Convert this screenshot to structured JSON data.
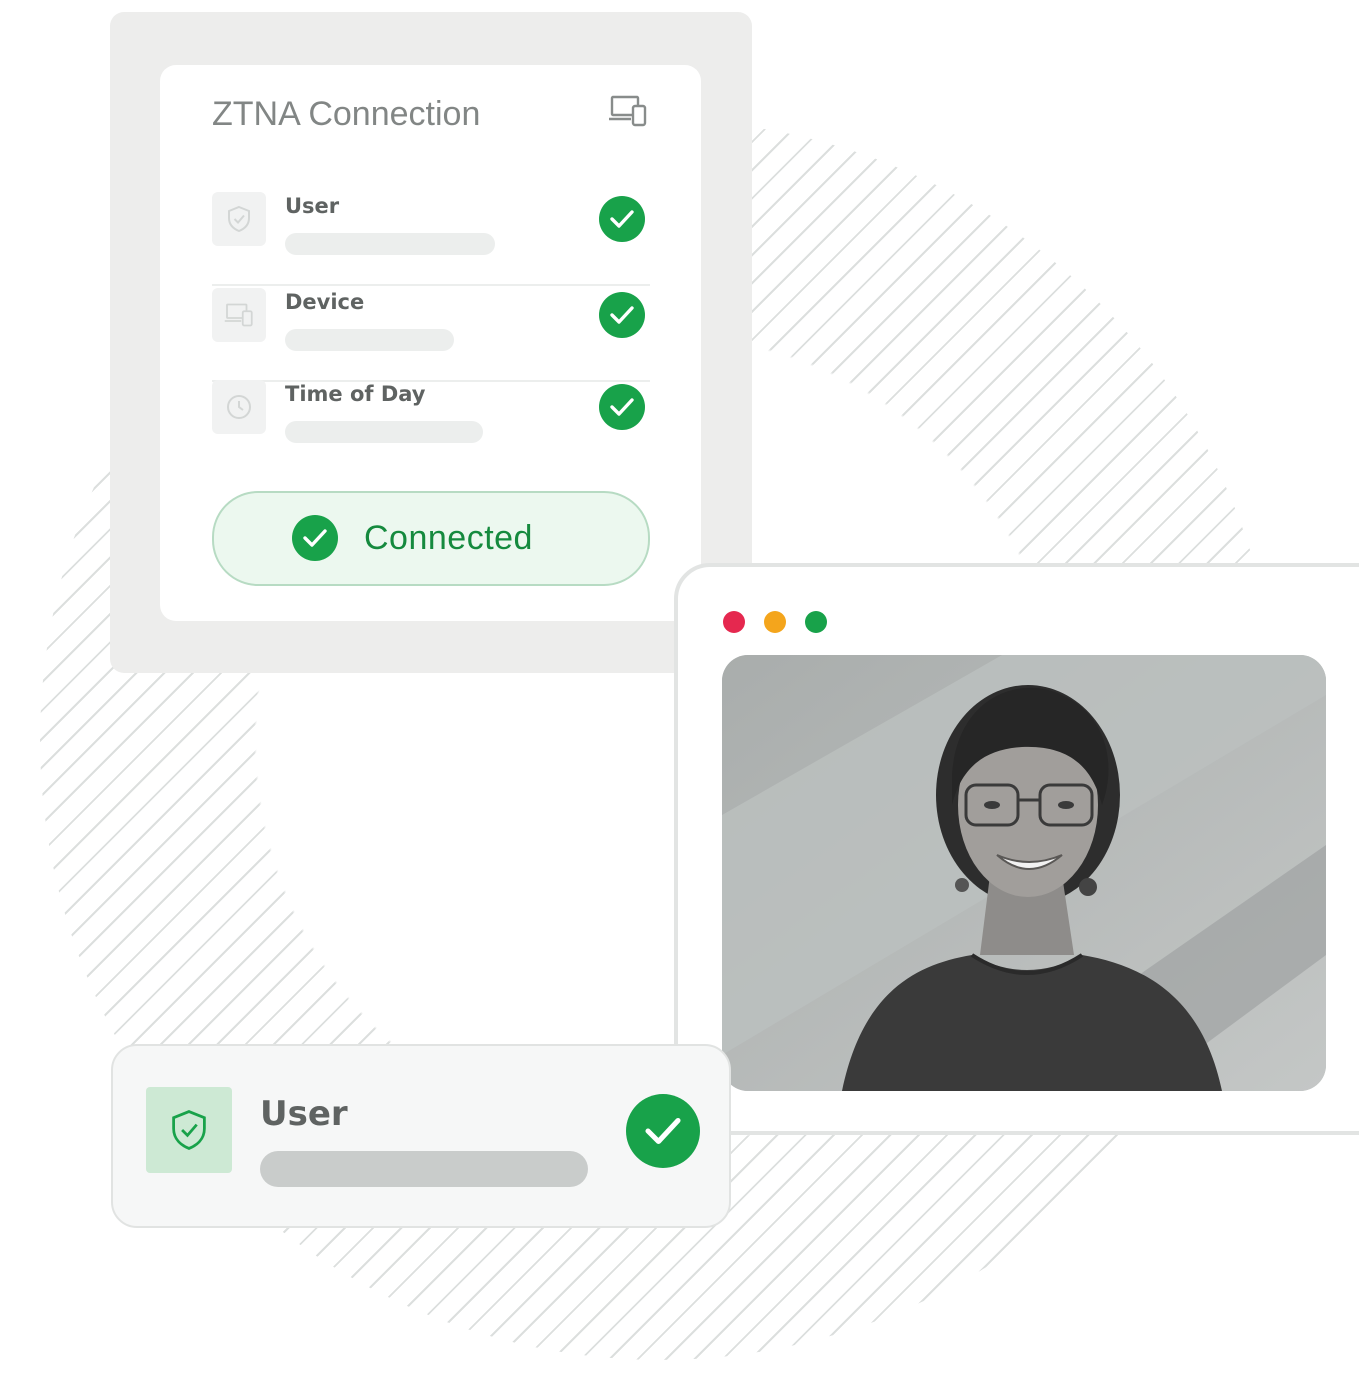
{
  "ztna": {
    "title": "ZTNA Connection",
    "title_icon": "devices-icon",
    "rows": [
      {
        "label": "User",
        "icon": "shield-check-icon",
        "status": "check-circle-icon"
      },
      {
        "label": "Device",
        "icon": "devices-icon",
        "status": "check-circle-icon"
      },
      {
        "label": "Time of Day",
        "icon": "clock-icon",
        "status": "check-circle-icon"
      }
    ],
    "status_button": {
      "label": "Connected",
      "icon": "check-circle-icon"
    }
  },
  "video_window": {
    "window_controls": [
      {
        "name": "close",
        "color": "#e5284f"
      },
      {
        "name": "minimize",
        "color": "#f4a51c"
      },
      {
        "name": "maximize",
        "color": "#18a24a"
      }
    ],
    "photo": "person-portrait"
  },
  "user_card": {
    "label": "User",
    "icon": "shield-check-icon",
    "status": "check-circle-icon"
  },
  "colors": {
    "accent_green": "#18a24a",
    "connected_bg": "#ecf8ef",
    "panel_gray": "#ededec",
    "text_gray": "#5f6362"
  }
}
